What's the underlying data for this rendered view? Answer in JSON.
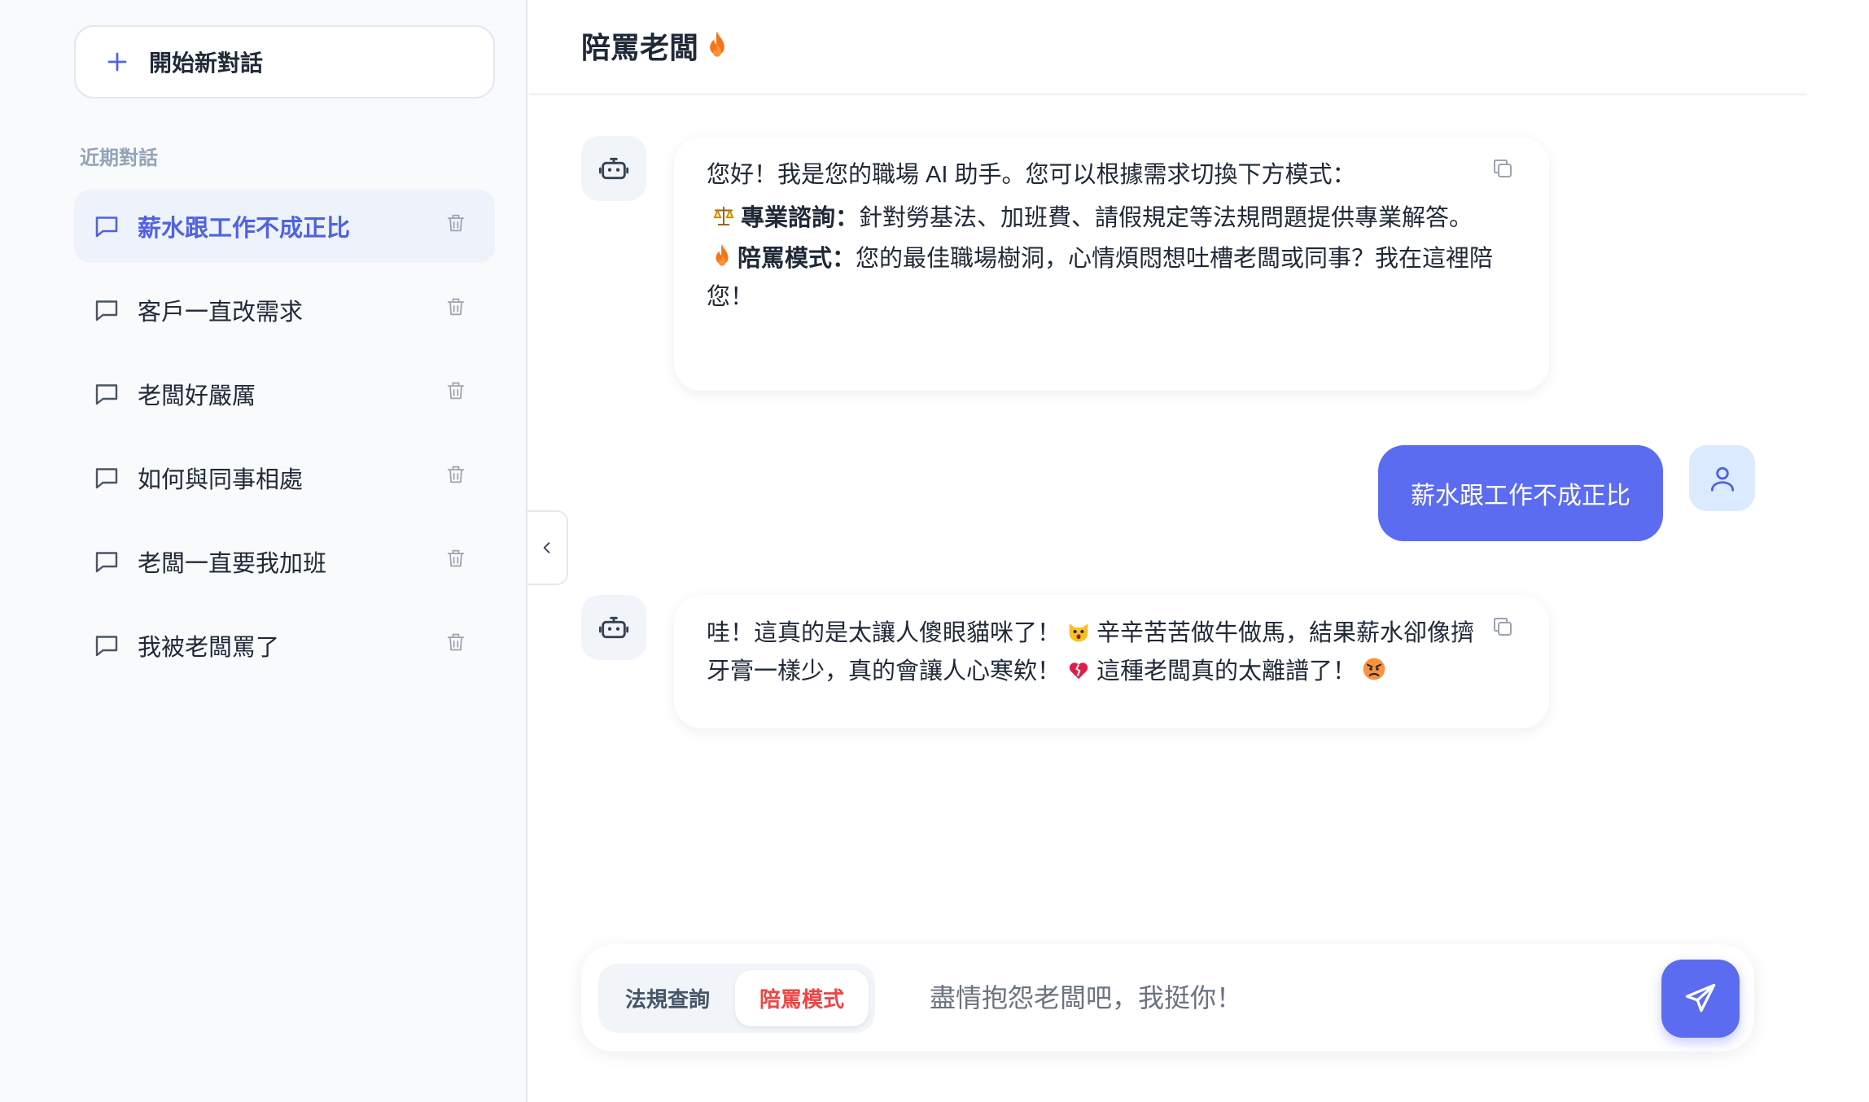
{
  "sidebar": {
    "new_chat_label": "開始新對話",
    "section_label": "近期對話",
    "conversations": [
      {
        "label": "薪水跟工作不成正比",
        "active": true
      },
      {
        "label": "客戶一直改需求",
        "active": false
      },
      {
        "label": "老闆好嚴厲",
        "active": false
      },
      {
        "label": "如何與同事相處",
        "active": false
      },
      {
        "label": "老闆一直要我加班",
        "active": false
      },
      {
        "label": "我被老闆罵了",
        "active": false
      }
    ]
  },
  "header": {
    "title": "陪罵老闆",
    "title_icon": "fire-icon"
  },
  "messages": [
    {
      "role": "assistant",
      "intro": "您好！我是您的職場 AI 助手。您可以根據需求切換下方模式：",
      "items": [
        {
          "icon": "scales-icon",
          "title": "專業諮詢",
          "sep": "：",
          "text": "針對勞基法、加班費、請假規定等法規問題提供專業解答。"
        },
        {
          "icon": "fire-icon",
          "title": "陪罵模式",
          "sep": "：",
          "text": "您的最佳職場樹洞，心情煩悶想吐槽老闆或同事？我在這裡陪您！"
        }
      ]
    },
    {
      "role": "user",
      "text": "薪水跟工作不成正比"
    },
    {
      "role": "assistant",
      "part1": "哇！這真的是太讓人傻眼貓咪了！",
      "part2": "辛辛苦苦做牛做馬，結果薪水卻像擠牙膏一樣少，真的會讓人心寒欸！",
      "part3": "這種老闆真的太離譜了！",
      "emojis": [
        "scream-cat-emoji",
        "broken-heart-emoji",
        "angry-face-emoji"
      ]
    }
  ],
  "composer": {
    "mode_law": "法規查詢",
    "mode_vent": "陪罵模式",
    "active_mode": "陪罵模式",
    "placeholder": "盡情抱怨老闆吧，我挺你！",
    "value": ""
  },
  "colors": {
    "accent": "#5b6cf0",
    "active_text": "#4f63e0",
    "vent_red": "#ef4444"
  }
}
